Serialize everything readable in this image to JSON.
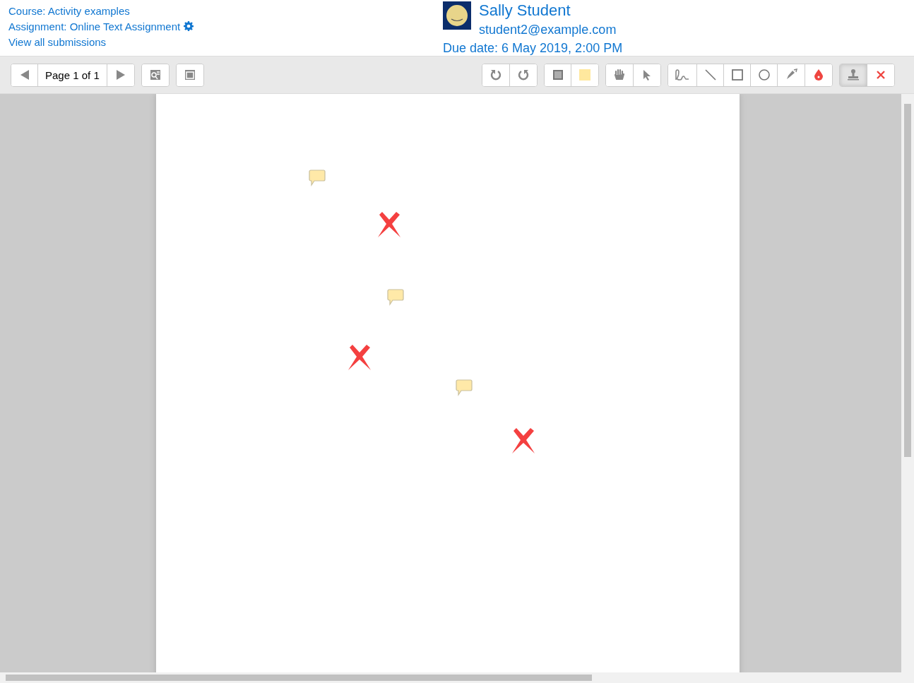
{
  "header": {
    "links": [
      "Course: Activity examples",
      "Assignment: Online Text Assignment",
      "View all submissions"
    ],
    "user": {
      "name": "Sally Student",
      "email": "student2@example.com"
    },
    "due_date": "Due date: 6 May 2019, 2:00 PM"
  },
  "navigation": {
    "page_label": "Page 1 of 1"
  },
  "tool_groups": [
    [
      {
        "kind": "rotate-left",
        "selected": false
      },
      {
        "kind": "rotate-right",
        "selected": false
      }
    ],
    [
      {
        "kind": "comment",
        "selected": false
      },
      {
        "kind": "swatch",
        "selected": false,
        "color": "#ffe89e"
      }
    ],
    [
      {
        "kind": "pan",
        "selected": false
      },
      {
        "kind": "select",
        "selected": false
      }
    ],
    [
      {
        "kind": "pen",
        "selected": false
      },
      {
        "kind": "line",
        "selected": false
      },
      {
        "kind": "rectangle",
        "selected": false
      },
      {
        "kind": "oval",
        "selected": false
      },
      {
        "kind": "highlighter",
        "selected": false
      },
      {
        "kind": "drop",
        "selected": false,
        "color": "#ef4540"
      }
    ],
    [
      {
        "kind": "stamp",
        "selected": true
      },
      {
        "kind": "cross",
        "selected": false
      }
    ]
  ],
  "annotations": [
    {
      "kind": "comment"
    },
    {
      "kind": "cross"
    },
    {
      "kind": "comment"
    },
    {
      "kind": "cross"
    },
    {
      "kind": "comment"
    },
    {
      "kind": "cross"
    }
  ]
}
